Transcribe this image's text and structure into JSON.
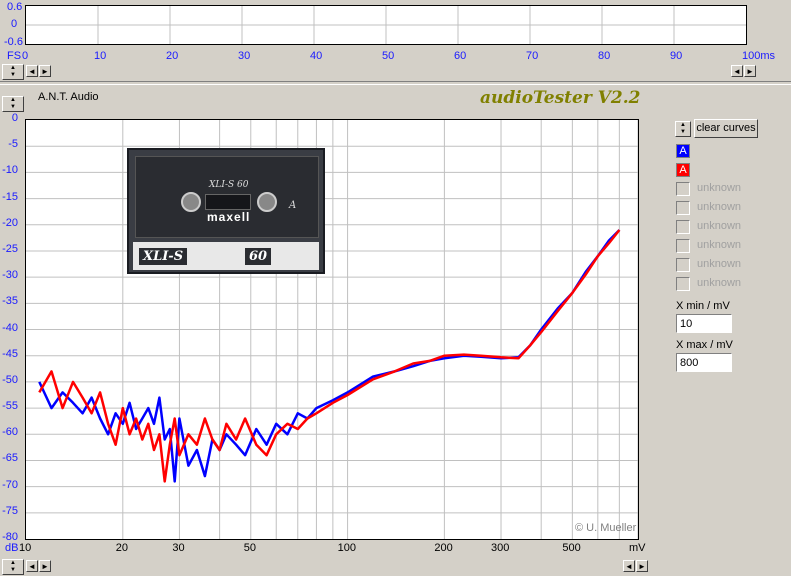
{
  "scope": {
    "y_ticks": [
      "0.6",
      "0",
      "-0.6"
    ],
    "x_ticks": [
      "0",
      "10",
      "20",
      "30",
      "40",
      "50",
      "60",
      "70",
      "80",
      "90",
      "100ms"
    ],
    "fs_label": "FS"
  },
  "header": {
    "brand": "A.N.T. Audio",
    "title": "audioTester V2.2"
  },
  "controls": {
    "clear_curves": "clear curves",
    "legend": [
      {
        "label": "A",
        "color": "#0000ff",
        "active": true
      },
      {
        "label": "A",
        "color": "#ff0000",
        "active": true
      },
      {
        "label": "unknown",
        "active": false
      },
      {
        "label": "unknown",
        "active": false
      },
      {
        "label": "unknown",
        "active": false
      },
      {
        "label": "unknown",
        "active": false
      },
      {
        "label": "unknown",
        "active": false
      },
      {
        "label": "unknown",
        "active": false
      }
    ],
    "xmin_label": "X min / mV",
    "xmin_value": "10",
    "xmax_label": "X max / mV",
    "xmax_value": "800"
  },
  "cassette": {
    "brand": "maxell",
    "model": "XLI-S",
    "length": "60",
    "model_top": "XLI-S 60",
    "side": "A"
  },
  "copyright": "© U. Mueller",
  "chart_data": {
    "type": "line",
    "x_scale": "log",
    "xlim": [
      10,
      800
    ],
    "ylim": [
      -80,
      0
    ],
    "ylabel": "dB",
    "xlabel": "mV",
    "y_ticks": [
      "0",
      "-5",
      "-10",
      "-15",
      "-20",
      "-25",
      "-30",
      "-35",
      "-40",
      "-45",
      "-50",
      "-55",
      "-60",
      "-65",
      "-70",
      "-75",
      "-80"
    ],
    "x_ticks": [
      "10",
      "20",
      "30",
      "50",
      "100",
      "200",
      "300",
      "500",
      "mV"
    ],
    "y_unit_label": "dB",
    "grid": true,
    "series": [
      {
        "color": "#0000ff",
        "x": [
          11,
          12,
          13,
          14,
          15,
          16,
          17,
          18,
          19,
          20,
          21,
          22,
          23,
          24,
          25,
          26,
          27,
          28,
          29,
          30,
          32,
          34,
          36,
          38,
          40,
          42,
          45,
          48,
          52,
          56,
          60,
          65,
          70,
          75,
          80,
          90,
          100,
          120,
          140,
          160,
          180,
          200,
          230,
          260,
          300,
          340,
          370,
          400,
          450,
          500,
          550,
          600,
          650,
          700
        ],
        "y": [
          -50,
          -55,
          -52,
          -54,
          -56,
          -53,
          -57,
          -60,
          -56,
          -58,
          -54,
          -59,
          -57,
          -55,
          -58,
          -53,
          -61,
          -59,
          -69,
          -57,
          -66,
          -63,
          -68,
          -61,
          -63,
          -60,
          -62,
          -64,
          -59,
          -62,
          -58,
          -60,
          -56,
          -57,
          -55,
          -53.5,
          -52,
          -49,
          -48,
          -47,
          -46,
          -45.5,
          -45,
          -45.2,
          -45.5,
          -45.3,
          -43,
          -40,
          -36,
          -33,
          -29,
          -26,
          -23,
          -21
        ]
      },
      {
        "color": "#ff0000",
        "x": [
          11,
          12,
          13,
          14,
          15,
          16,
          17,
          18,
          19,
          20,
          21,
          22,
          23,
          24,
          25,
          26,
          27,
          28,
          29,
          30,
          32,
          34,
          36,
          38,
          40,
          42,
          45,
          48,
          52,
          56,
          60,
          65,
          70,
          75,
          80,
          90,
          100,
          120,
          140,
          160,
          180,
          200,
          230,
          260,
          300,
          340,
          370,
          400,
          450,
          500,
          550,
          600,
          650,
          700
        ],
        "y": [
          -52,
          -48,
          -55,
          -50,
          -53,
          -56,
          -52,
          -58,
          -62,
          -55,
          -60,
          -57,
          -61,
          -58,
          -63,
          -60,
          -69,
          -62,
          -57,
          -64,
          -60,
          -62,
          -57,
          -61,
          -63,
          -58,
          -61,
          -57,
          -62,
          -64,
          -60,
          -58,
          -59,
          -57,
          -56,
          -54,
          -52.5,
          -49.5,
          -48,
          -46.5,
          -46,
          -45,
          -44.8,
          -45,
          -45.3,
          -45.5,
          -43,
          -40.5,
          -36.5,
          -33,
          -29.5,
          -26,
          -23.5,
          -21
        ]
      }
    ]
  }
}
